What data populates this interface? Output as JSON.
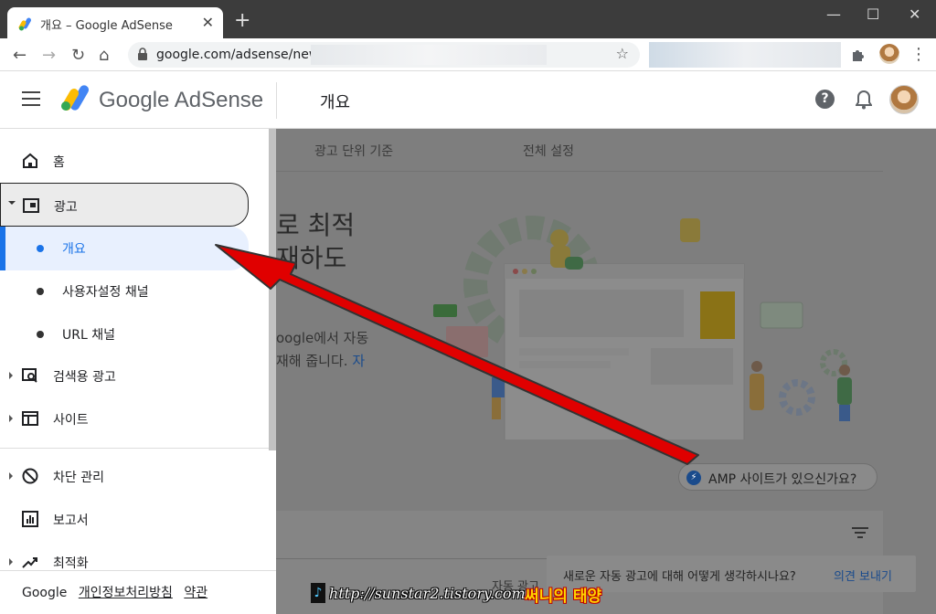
{
  "browser": {
    "tab_title": "개요 – Google AdSense",
    "tab_close": "✕",
    "new_tab": "+",
    "win_min": "—",
    "win_max": "☐",
    "win_close": "✕",
    "url": "google.com/adsense/new/u",
    "star": "☆",
    "back": "←",
    "forward": "→",
    "reload": "↻",
    "home": "⌂",
    "more": "⋮"
  },
  "header": {
    "brand": "Google AdSense",
    "page_title": "개요",
    "help": "?"
  },
  "sidebar": {
    "home": "홈",
    "ads": "광고",
    "overview": "개요",
    "custom_channels": "사용자설정 채널",
    "url_channels": "URL 채널",
    "search_ads": "검색용 광고",
    "sites": "사이트",
    "blocking": "차단 관리",
    "reports": "보고서",
    "optimization": "최적화"
  },
  "footer": {
    "google": "Google",
    "privacy": "개인정보처리방침",
    "terms": "약관"
  },
  "content": {
    "tab_by_unit": "광고 단위 기준",
    "tab_global": "전체 설정",
    "headline_1": "로 최적",
    "headline_2": "재하도",
    "body_1": "oogle에서 자동",
    "body_2": "재해 줍니다.",
    "body_link": "자",
    "amp_question": "AMP 사이트가 있으신가요?",
    "amp_icon": "⚡",
    "column_auto_ads": "자동 광고"
  },
  "feedback": {
    "question": "새로운 자동 광고에 대해 어떻게 생각하시나요?",
    "send": "의견 보내기"
  },
  "watermark": {
    "note": "♪",
    "url": "http://sunstar2.tistory.com",
    "name": "써니의 태양"
  },
  "colors": {
    "accent_blue": "#1a73e8",
    "arrow_red": "#e00000",
    "dim_overlay": "#7e7e7e"
  }
}
